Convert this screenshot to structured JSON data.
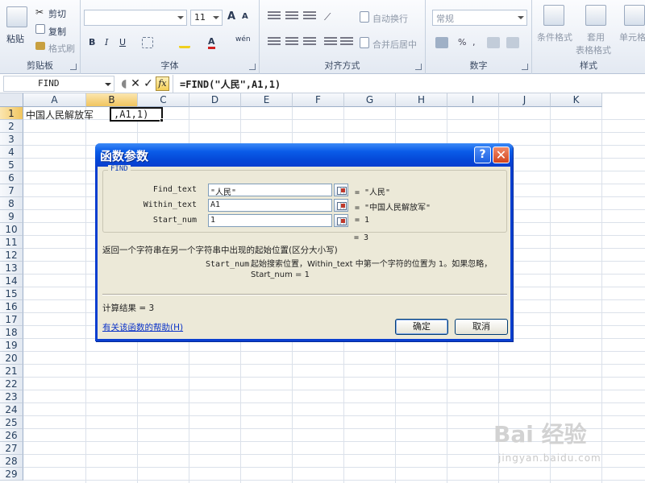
{
  "ribbon": {
    "clipboard": {
      "paste": "粘贴",
      "cut": "剪切",
      "copy": "复制",
      "format_painter": "格式刷",
      "label": "剪贴板"
    },
    "font": {
      "size": "11",
      "bold": "B",
      "italic": "I",
      "underline": "U",
      "grow": "A",
      "shrink": "A",
      "color": "A",
      "phonetic": "wén",
      "label": "字体"
    },
    "alignment": {
      "wrap": "自动换行",
      "merge": "合并后居中",
      "label": "对齐方式"
    },
    "number": {
      "format": "常规",
      "label": "数字"
    },
    "styles": {
      "conditional": "条件格式",
      "table": "套用",
      "table2": "表格格式",
      "cell": "单元格",
      "label": "样式"
    }
  },
  "formula_bar": {
    "name_box": "FIND",
    "formula": "=FIND(\"人民\",A1,1)",
    "fx": "fx"
  },
  "grid": {
    "columns": [
      "A",
      "B",
      "C",
      "D",
      "E",
      "F",
      "G",
      "H",
      "I",
      "J",
      "K"
    ],
    "rows": [
      "1",
      "2",
      "3",
      "4",
      "5",
      "6",
      "7",
      "8",
      "9",
      "10",
      "11",
      "12",
      "13",
      "14",
      "15",
      "16",
      "17",
      "18",
      "19",
      "20",
      "21",
      "22",
      "23",
      "24",
      "25",
      "26",
      "27",
      "28",
      "29"
    ],
    "a1": "中国人民解放军",
    "b1": ",A1,1)"
  },
  "dialog": {
    "title": "函数参数",
    "help_btn": "?",
    "close_btn": "✕",
    "function_name": "FIND",
    "params": [
      {
        "label": "Find_text",
        "value": "\"人民\"",
        "result": "= \"人民\""
      },
      {
        "label": "Within_text",
        "value": "A1",
        "result": "= \"中国人民解放军\""
      },
      {
        "label": "Start_num",
        "value": "1",
        "result": "= 1"
      }
    ],
    "formula_result": "= 3",
    "description": "返回一个字符串在另一个字符串中出现的起始位置(区分大小写)",
    "arg_name": "Start_num",
    "arg_description": "起始搜索位置，Within_text 中第一个字符的位置为 1。如果忽略，Start_num = 1",
    "calc_result": "计算结果 =  3",
    "help_link": "有关该函数的帮助(H)",
    "ok": "确定",
    "cancel": "取消"
  },
  "watermark": {
    "brand": "Bai 经验",
    "url": "jingyan.baidu.com"
  }
}
